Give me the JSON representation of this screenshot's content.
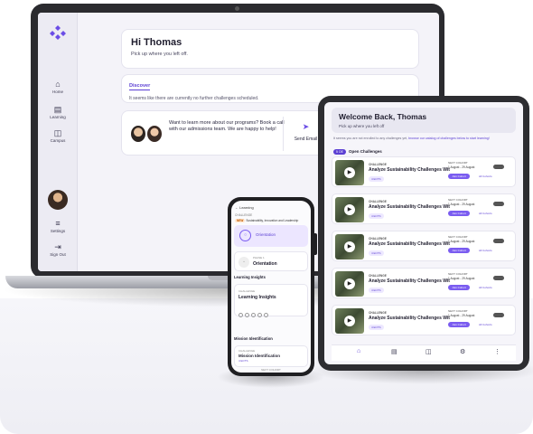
{
  "laptop": {
    "sidebar": {
      "nav": [
        {
          "label": "Home",
          "icon": "home-icon",
          "glyph": "⌂"
        },
        {
          "label": "Learning",
          "icon": "book-icon",
          "glyph": "▤"
        },
        {
          "label": "Campus",
          "icon": "campus-icon",
          "glyph": "◫"
        }
      ],
      "bottom": [
        {
          "label": "Settings",
          "icon": "settings-icon",
          "glyph": "≡"
        },
        {
          "label": "Sign Out",
          "icon": "signout-icon",
          "glyph": "⇥"
        }
      ]
    },
    "greeting": {
      "title": "Hi Thomas",
      "subtitle": "Pick up where you left off."
    },
    "discover": {
      "tab": "Discover",
      "message": "It seems like there are currently no further challenges scheduled."
    },
    "promo": {
      "text": "Want to learn more about our programs? Book a call with our admissions team. We are happy to help!",
      "action": "Send Email"
    }
  },
  "tablet": {
    "title": "Welcome Back, Thomas",
    "subtitle": "Pick up where you left off",
    "notice": "It seems you are not enrolled to any challenges yet,",
    "notice_link": "browse our catalog of challenges below to start learning!",
    "open_badge": "5 OE",
    "open_label": "Open Challenges",
    "rows": [
      {
        "kind": "CHALLENGE",
        "title": "Analyze Sustainability Challenges Wit",
        "badge": "4 ECTS",
        "next": "NEXT COHORT",
        "date": "1 August - 29 August",
        "join": "Join Cohort",
        "all": "All Cohorts"
      },
      {
        "kind": "CHALLENGE",
        "title": "Analyze Sustainability Challenges Wit",
        "badge": "4 ECTS",
        "next": "NEXT COHORT",
        "date": "1 August - 29 August",
        "join": "Join Cohort",
        "all": "All Cohorts"
      },
      {
        "kind": "CHALLENGE",
        "title": "Analyze Sustainability Challenges Wit",
        "badge": "4 ECTS",
        "next": "NEXT COHORT",
        "date": "1 August - 29 August",
        "join": "Join Cohort",
        "all": "All Cohorts"
      },
      {
        "kind": "CHALLENGE",
        "title": "Analyze Sustainability Challenges Wit",
        "badge": "4 ECTS",
        "next": "NEXT COHORT",
        "date": "1 August - 29 August",
        "join": "Join Cohort",
        "all": "All Cohorts"
      },
      {
        "kind": "CHALLENGE",
        "title": "Analyze Sustainability Challenges Wit",
        "badge": "4 ECTS",
        "next": "NEXT COHORT",
        "date": "1 August - 29 August",
        "join": "Join Cohort",
        "all": "All Cohorts"
      }
    ],
    "bottom_nav": [
      {
        "icon": "home-icon",
        "glyph": "⌂"
      },
      {
        "icon": "book-icon",
        "glyph": "▤"
      },
      {
        "icon": "campus-icon",
        "glyph": "◫"
      },
      {
        "icon": "settings-icon",
        "glyph": "⚙"
      },
      {
        "icon": "more-icon",
        "glyph": "⋮"
      }
    ]
  },
  "phone": {
    "back": "← Learning",
    "tag": "CHALLENGE",
    "new_badge": "NEW",
    "program": "Sustainability, Innovation and Leadership",
    "orientation": "Orientation",
    "pre_label": "PHASE 1",
    "step2": "Orientation",
    "section1": "Learning Insights",
    "card_kind": "CHALLENGE",
    "card_title": "Learning Insights",
    "section2": "Mission Identification",
    "card2_kind": "CHALLENGE",
    "card2_title": "Mission Identification",
    "card2_badge": "4 ECTS",
    "footer": "NEXT COHORT"
  },
  "colors": {
    "accent": "#5b3fd3",
    "accent_light": "#7a5cf0"
  }
}
